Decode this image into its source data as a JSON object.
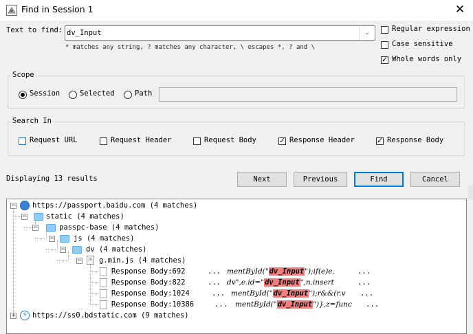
{
  "window": {
    "title": "Find in Session 1",
    "close": "✕"
  },
  "find": {
    "label": "Text to find:",
    "value": "dv_Input",
    "hint": "* matches any string, ? matches any character, \\ escapes *, ? and \\"
  },
  "options": [
    {
      "label": "Regular expression",
      "checked": false
    },
    {
      "label": "Case sensitive",
      "checked": false
    },
    {
      "label": "Whole words only",
      "checked": true
    }
  ],
  "scope": {
    "title": "Scope",
    "options": [
      {
        "label": "Session",
        "checked": true
      },
      {
        "label": "Selected",
        "checked": false
      },
      {
        "label": "Path",
        "checked": false
      }
    ],
    "path_value": ""
  },
  "search_in": {
    "title": "Search In",
    "options": [
      {
        "label": "Request URL",
        "checked": false
      },
      {
        "label": "Request Header",
        "checked": false
      },
      {
        "label": "Request Body",
        "checked": false
      },
      {
        "label": "Response Header",
        "checked": true
      },
      {
        "label": "Response Body",
        "checked": true
      }
    ]
  },
  "status": "Displaying 13 results",
  "buttons": {
    "next": "Next",
    "previous": "Previous",
    "find": "Find",
    "cancel": "Cancel"
  },
  "tree": {
    "nodes": [
      {
        "label": "https://passport.baidu.com (4 matches)",
        "icon": "globe-icon",
        "expander": "minus"
      },
      {
        "label": "static (4 matches)",
        "icon": "folder-icon",
        "expander": "minus"
      },
      {
        "label": "passpc-base (4 matches)",
        "icon": "folder-icon",
        "expander": "minus"
      },
      {
        "label": "js (4 matches)",
        "icon": "folder-icon",
        "expander": "minus"
      },
      {
        "label": "dv (4 matches)",
        "icon": "folder-icon",
        "expander": "minus"
      },
      {
        "label": "g.min.js (4 matches)",
        "icon": "js-file-icon",
        "expander": "minus"
      }
    ],
    "results": [
      {
        "label": "Response Body:692",
        "pre": "...",
        "before": "mentById(\"",
        "match": "dv_Input",
        "after": "\");if(e)e.",
        "post": "..."
      },
      {
        "label": "Response Body:822",
        "pre": "...",
        "before": "dv\",e.id=\"",
        "match": "dv_Input",
        "after": "\",n.insert",
        "post": "..."
      },
      {
        "label": "Response Body:1024",
        "pre": "...",
        "before": "mentById(\"",
        "match": "dv_Input",
        "after": "\");r&&(r.v",
        "post": "..."
      },
      {
        "label": "Response Body:10386",
        "pre": "...",
        "before": "mentById(\"",
        "match": "dv_Input",
        "after": "\")},z=func",
        "post": "..."
      }
    ],
    "second_host": {
      "label": "https://ss0.bdstatic.com (9 matches)",
      "icon": "lightning-icon",
      "expander": "plus"
    }
  }
}
